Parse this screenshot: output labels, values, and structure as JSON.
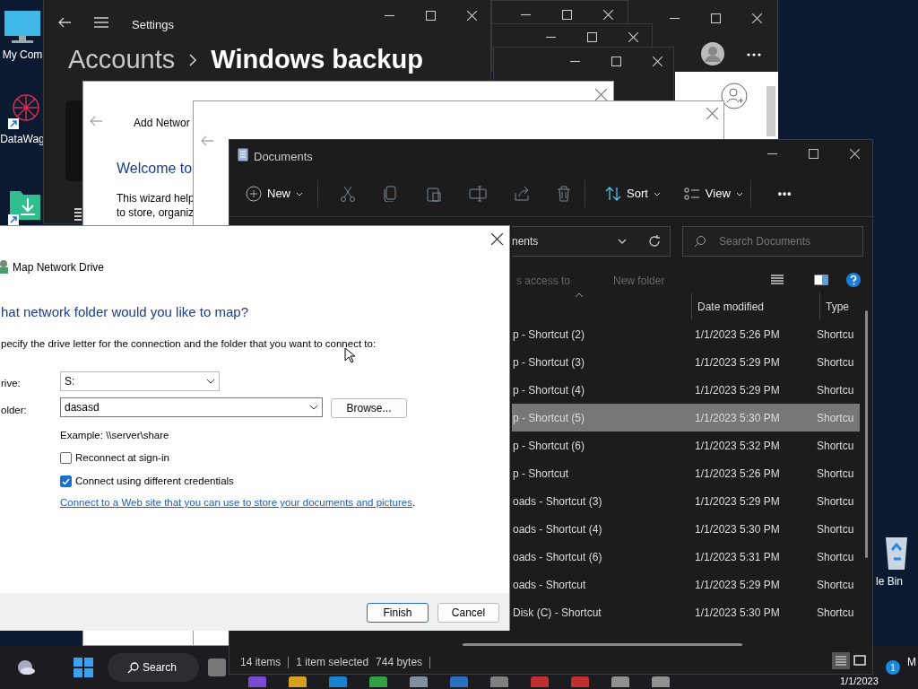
{
  "desktop_icons": [
    {
      "kind": "monitor",
      "label": "My Com"
    },
    {
      "kind": "star",
      "label": "DataWag"
    },
    {
      "kind": "download"
    }
  ],
  "recycle_bin": {
    "label": "le Bin"
  },
  "settings": {
    "title": "Settings",
    "breadcrumb": [
      "Accounts",
      "Windows backup"
    ]
  },
  "wizard": {
    "title": "Add Networ",
    "heading": "Welcome to",
    "lines": [
      "This wizard help",
      "to store, organiz"
    ]
  },
  "explorer": {
    "title": "Documents",
    "toolbar": [
      {
        "kind": "new",
        "label": "New"
      },
      {
        "kind": "cut"
      },
      {
        "kind": "copy"
      },
      {
        "kind": "paste"
      },
      {
        "kind": "rename"
      },
      {
        "kind": "share"
      },
      {
        "kind": "delete"
      },
      {
        "kind": "sort",
        "label": "Sort"
      },
      {
        "kind": "view",
        "label": "View"
      },
      {
        "kind": "more",
        "label": "•••"
      }
    ],
    "address": "nents",
    "search": {
      "placeholder": "Search Documents"
    },
    "subbar": [
      "s access to",
      "New folder"
    ],
    "columns": [
      "Date modified",
      "Type"
    ],
    "rows": [
      {
        "name": "p - Shortcut (2)",
        "date": "1/1/2023 5:26 PM",
        "type": "Shortcu",
        "selected": false
      },
      {
        "name": "p - Shortcut (3)",
        "date": "1/1/2023 5:29 PM",
        "type": "Shortcu",
        "selected": false
      },
      {
        "name": "p - Shortcut (4)",
        "date": "1/1/2023 5:29 PM",
        "type": "Shortcu",
        "selected": false
      },
      {
        "name": "p - Shortcut (5)",
        "date": "1/1/2023 5:30 PM",
        "type": "Shortcu",
        "selected": true
      },
      {
        "name": "p - Shortcut (6)",
        "date": "1/1/2023 5:32 PM",
        "type": "Shortcu",
        "selected": false
      },
      {
        "name": "p - Shortcut",
        "date": "1/1/2023 5:26 PM",
        "type": "Shortcu",
        "selected": false
      },
      {
        "name": "oads - Shortcut (3)",
        "date": "1/1/2023 5:29 PM",
        "type": "Shortcu",
        "selected": false
      },
      {
        "name": "oads - Shortcut (4)",
        "date": "1/1/2023 5:30 PM",
        "type": "Shortcu",
        "selected": false
      },
      {
        "name": "oads - Shortcut (6)",
        "date": "1/1/2023 5:31 PM",
        "type": "Shortcu",
        "selected": false
      },
      {
        "name": "oads - Shortcut",
        "date": "1/1/2023 5:29 PM",
        "type": "Shortcu",
        "selected": false
      },
      {
        "name": "Disk (C) - Shortcut",
        "date": "1/1/2023 5:30 PM",
        "type": "Shortcu",
        "selected": false
      }
    ],
    "status": [
      "14 items",
      "1 item selected",
      "744 bytes"
    ],
    "view_buttons": [
      {
        "kind": "details",
        "selected": true
      },
      {
        "kind": "tiles",
        "selected": false
      }
    ]
  },
  "dialog": {
    "title": "Map Network Drive",
    "heading": "hat network folder would you like to map?",
    "instruction": "pecify the drive letter for the connection and the folder that you want to connect to:",
    "drive_label": "rive:",
    "drive": "S:",
    "folder_label": "older:",
    "folder": "dasasd",
    "browse": "Browse...",
    "example": "Example: \\\\server\\share",
    "options": [
      {
        "label": "Reconnect at sign-in",
        "checked": false
      },
      {
        "label": "Connect using different credentials",
        "checked": true
      }
    ],
    "link": "Connect to a Web site that you can use to store your documents and pictures",
    "link_suffix": ".",
    "buttons": [
      {
        "label": "Finish",
        "selected": true
      },
      {
        "label": "Cancel",
        "selected": false
      }
    ]
  },
  "taskbar": {
    "search": "Search",
    "time": "M",
    "date": "1/1/2023",
    "badge": "1"
  }
}
